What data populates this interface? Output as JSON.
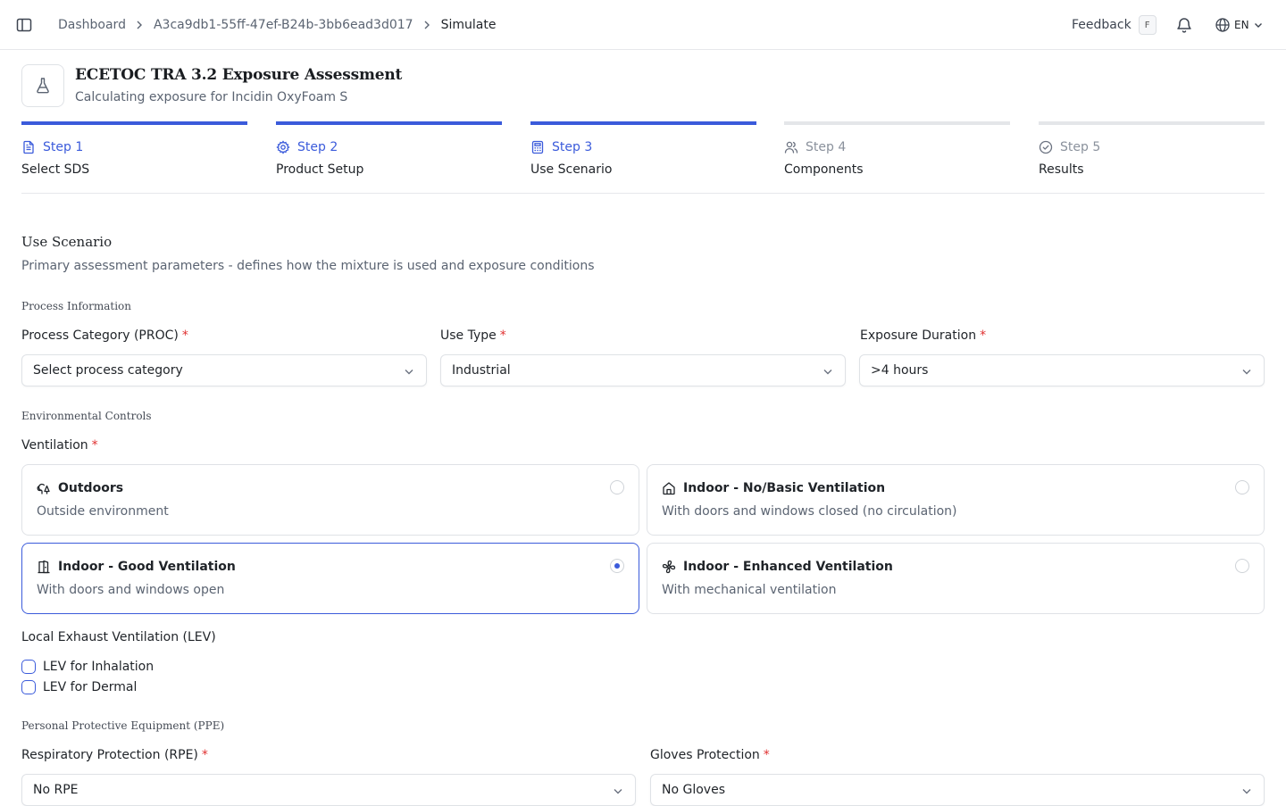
{
  "breadcrumb": {
    "items": [
      "Dashboard",
      "A3ca9db1-55ff-47ef-B24b-3bb6ead3d017",
      "Simulate"
    ]
  },
  "topbar": {
    "feedback_label": "Feedback",
    "feedback_shortcut": "F",
    "language": "EN"
  },
  "header": {
    "title": "ECETOC TRA 3.2 Exposure Assessment",
    "subtitle": "Calculating exposure for Incidin OxyFoam S"
  },
  "steps": [
    {
      "number": "Step 1",
      "name": "Select SDS",
      "icon": "file-text-icon",
      "complete": true
    },
    {
      "number": "Step 2",
      "name": "Product Setup",
      "icon": "gear-icon",
      "complete": true
    },
    {
      "number": "Step 3",
      "name": "Use Scenario",
      "icon": "calculator-icon",
      "complete": true
    },
    {
      "number": "Step 4",
      "name": "Components",
      "icon": "users-icon",
      "complete": false
    },
    {
      "number": "Step 5",
      "name": "Results",
      "icon": "check-circle-icon",
      "complete": false
    }
  ],
  "section": {
    "title": "Use Scenario",
    "description": "Primary assessment parameters - defines how the mixture is used and exposure conditions"
  },
  "process_info": {
    "group_label": "Process Information",
    "proc": {
      "label": "Process Category (PROC)",
      "required": "*",
      "value": "Select process category"
    },
    "use_type": {
      "label": "Use Type",
      "required": "*",
      "value": "Industrial"
    },
    "exposure_duration": {
      "label": "Exposure Duration",
      "required": "*",
      "value": ">4 hours"
    }
  },
  "environmental": {
    "group_label": "Environmental Controls",
    "ventilation_label": "Ventilation",
    "ventilation_required": "*",
    "options": [
      {
        "title": "Outdoors",
        "desc": "Outside environment",
        "icon": "trees-icon",
        "selected": false
      },
      {
        "title": "Indoor - No/Basic Ventilation",
        "desc": "With doors and windows closed (no circulation)",
        "icon": "home-icon",
        "selected": false
      },
      {
        "title": "Indoor - Good Ventilation",
        "desc": "With doors and windows open",
        "icon": "door-open-icon",
        "selected": true
      },
      {
        "title": "Indoor - Enhanced Ventilation",
        "desc": "With mechanical ventilation",
        "icon": "fan-icon",
        "selected": false
      }
    ],
    "lev_label": "Local Exhaust Ventilation (LEV)",
    "lev_options": [
      {
        "label": "LEV for Inhalation",
        "checked": false
      },
      {
        "label": "LEV for Dermal",
        "checked": false
      }
    ]
  },
  "ppe": {
    "group_label": "Personal Protective Equipment (PPE)",
    "rpe": {
      "label": "Respiratory Protection (RPE)",
      "required": "*",
      "value": "No RPE"
    },
    "gloves": {
      "label": "Gloves Protection",
      "required": "*",
      "value": "No Gloves"
    }
  },
  "colors": {
    "accent": "#3b5bdb",
    "required": "#e03131",
    "muted_text": "#5b6472"
  }
}
